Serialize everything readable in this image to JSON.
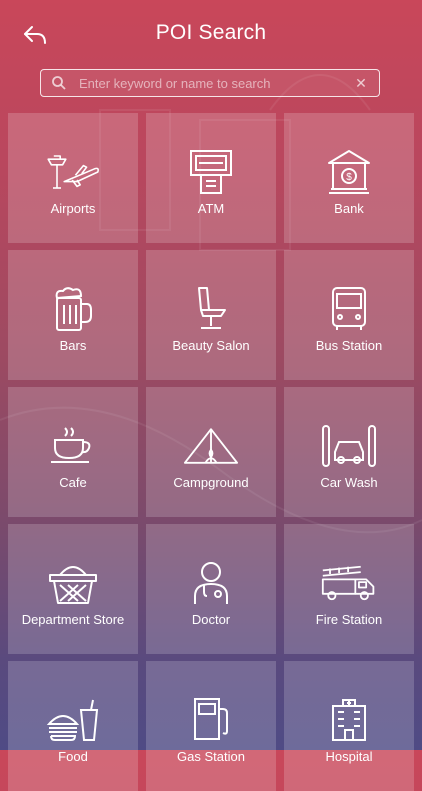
{
  "header": {
    "title": "POI Search"
  },
  "search": {
    "placeholder": "Enter keyword or name to search"
  },
  "categories": [
    {
      "label": "Airports",
      "icon": "airport-icon"
    },
    {
      "label": "ATM",
      "icon": "atm-icon"
    },
    {
      "label": "Bank",
      "icon": "bank-icon"
    },
    {
      "label": "Bars",
      "icon": "beer-mug-icon"
    },
    {
      "label": "Beauty Salon",
      "icon": "salon-chair-icon"
    },
    {
      "label": "Bus Station",
      "icon": "bus-icon"
    },
    {
      "label": "Cafe",
      "icon": "coffee-cup-icon"
    },
    {
      "label": "Campground",
      "icon": "tent-icon"
    },
    {
      "label": "Car Wash",
      "icon": "car-wash-icon"
    },
    {
      "label": "Department Store",
      "icon": "basket-icon"
    },
    {
      "label": "Doctor",
      "icon": "doctor-icon"
    },
    {
      "label": "Fire Station",
      "icon": "fire-truck-icon"
    },
    {
      "label": "Food",
      "icon": "fast-food-icon"
    },
    {
      "label": "Gas Station",
      "icon": "gas-pump-icon"
    },
    {
      "label": "Hospital",
      "icon": "hospital-icon"
    }
  ]
}
